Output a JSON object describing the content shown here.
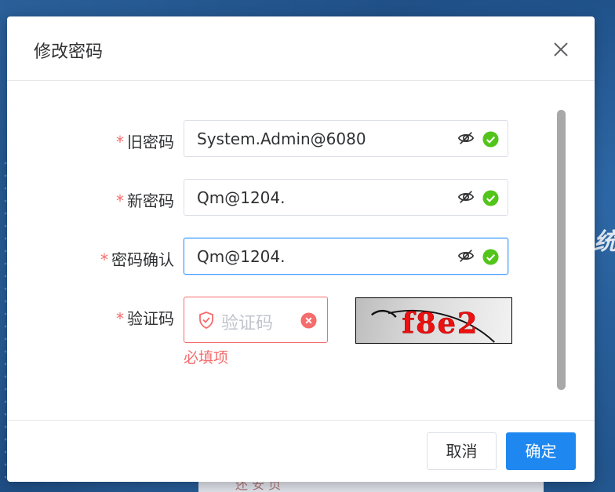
{
  "background": {
    "partial_title": "统",
    "partial_panel_text": "还 安 页"
  },
  "dialog": {
    "title": "修改密码",
    "form": {
      "old_password": {
        "label": "旧密码",
        "value": "System.Admin@6080"
      },
      "new_password": {
        "label": "新密码",
        "value": "Qm@1204."
      },
      "confirm_password": {
        "label": "密码确认",
        "value": "Qm@1204."
      },
      "captcha": {
        "label": "验证码",
        "placeholder": "验证码",
        "error": "必填项",
        "image_text": "f8e2"
      }
    },
    "buttons": {
      "cancel": "取消",
      "confirm": "确定"
    }
  },
  "colors": {
    "required": "#f56c6c",
    "primary": "#1e88f0",
    "success": "#52c41a",
    "error": "#f56c6c"
  },
  "icons": [
    "close-icon",
    "eye-off-icon",
    "check-circle-icon",
    "shield-icon",
    "clear-error-icon"
  ]
}
